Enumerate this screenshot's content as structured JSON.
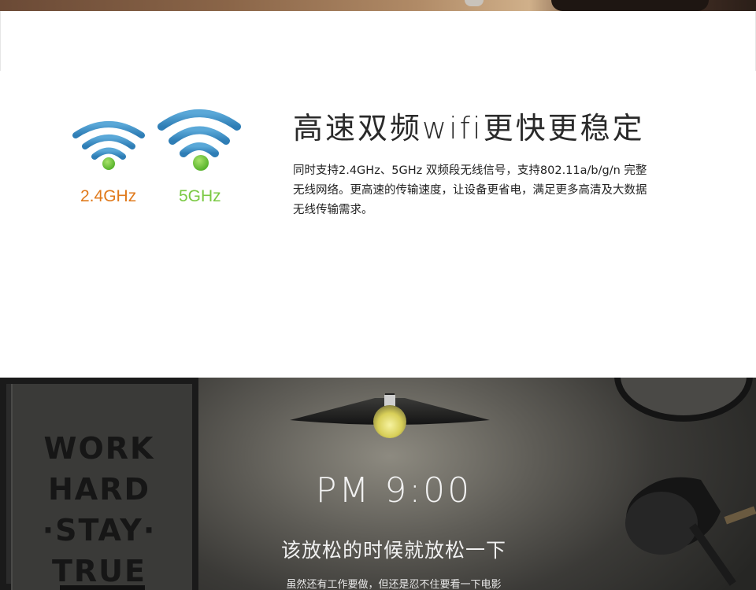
{
  "wifi_section": {
    "band_24": "2.4GHz",
    "band_5": "5GHz",
    "heading": "高速双频wifi更快更稳定",
    "desc_lines": [
      "同时支持2.4GHz、5GHz 双频段无线信号，支持802.11a/b/g/n 完整",
      "无线网络。更高速的传输速度，让设备更省电，满足更多高清及大数据",
      "无线传输需求。"
    ]
  },
  "scene": {
    "poster_lines": [
      "WORK",
      "HARD",
      "·STAY·",
      "TRUE"
    ],
    "time": "PM 9:00",
    "subtitle": "该放松的时候就放松一下",
    "caption": "虽然还有工作要做，但还是忍不住要看一下电影"
  },
  "colors": {
    "band_24": "#e07a1c",
    "band_5": "#7ac943",
    "wifi_blue": "#3e8fc4",
    "wifi_dot": "#6cc23c"
  },
  "icons": [
    "wifi-icon",
    "pendant-lamp-icon",
    "desk-lamp-icon"
  ]
}
